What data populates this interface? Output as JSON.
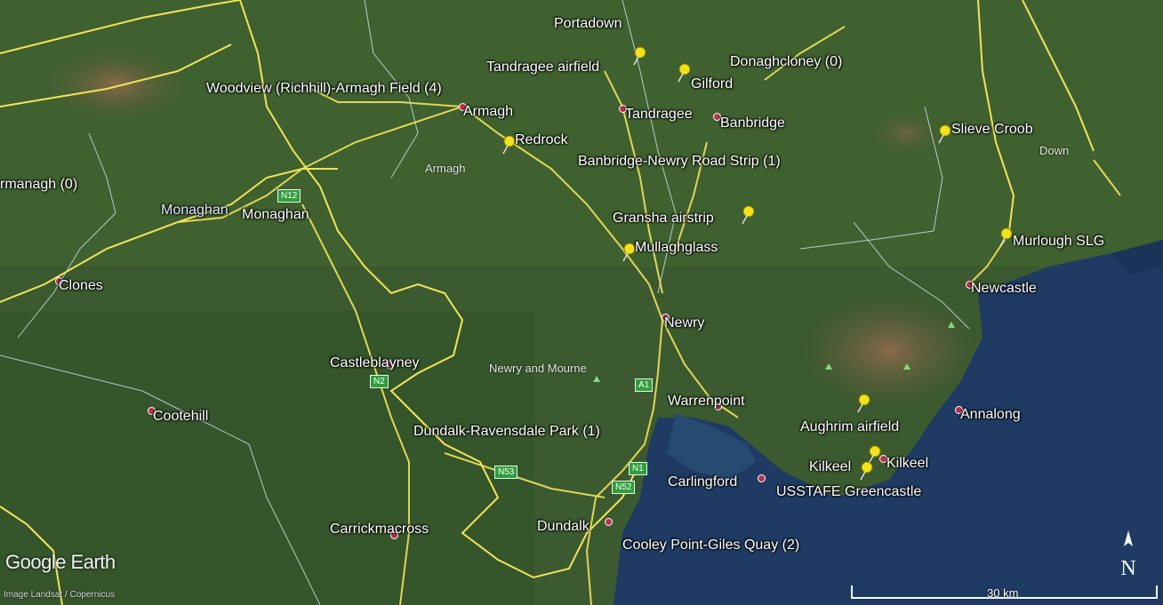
{
  "map": {
    "branding": "Google Earth",
    "credit": "Image Landsat / Copernicus",
    "scale_label": "30 km",
    "north_label": "N",
    "colors": {
      "land": "#3a5a2e",
      "sea": "#1f3d66",
      "road": "#f3e35a",
      "border": "#cfe9f0",
      "pin": "#f2e21b",
      "town_dot": "#b5324a"
    }
  },
  "places": [
    {
      "name": "Portadown"
    },
    {
      "name": "Tandragee airfield"
    },
    {
      "name": "Donaghcloney (0)"
    },
    {
      "name": "Gilford"
    },
    {
      "name": "Woodview (Richhill)-Armagh Field (4)"
    },
    {
      "name": "Armagh"
    },
    {
      "name": "Tandragee"
    },
    {
      "name": "Banbridge"
    },
    {
      "name": "Redrock"
    },
    {
      "name": "Slieve Croob"
    },
    {
      "name": "Banbridge-Newry Road Strip (1)"
    },
    {
      "name": "Armagh"
    },
    {
      "name": "Down"
    },
    {
      "name": "rmanagh (0)"
    },
    {
      "name": "Monaghan"
    },
    {
      "name": "Monaghan"
    },
    {
      "name": "Gransha airstrip"
    },
    {
      "name": "Mullaghglass"
    },
    {
      "name": "Murlough SLG"
    },
    {
      "name": "Clones"
    },
    {
      "name": "Newcastle"
    },
    {
      "name": "Newry"
    },
    {
      "name": "Castleblayney"
    },
    {
      "name": "Newry and Mourne"
    },
    {
      "name": "Warrenpoint"
    },
    {
      "name": "Cootehill"
    },
    {
      "name": "Aughrim airfield"
    },
    {
      "name": "Annalong"
    },
    {
      "name": "Dundalk-Ravensdale Park (1)"
    },
    {
      "name": "Kilkeel"
    },
    {
      "name": "Kilkeel"
    },
    {
      "name": "Carlingford"
    },
    {
      "name": "USSTAFE Greencastle"
    },
    {
      "name": "Carrickmacross"
    },
    {
      "name": "Dundalk"
    },
    {
      "name": "Cooley Point-Giles Quay (2)"
    }
  ],
  "road_shields": [
    {
      "label": "N12"
    },
    {
      "label": "N2"
    },
    {
      "label": "A1"
    },
    {
      "label": "N53"
    },
    {
      "label": "N1"
    },
    {
      "label": "N52"
    }
  ]
}
